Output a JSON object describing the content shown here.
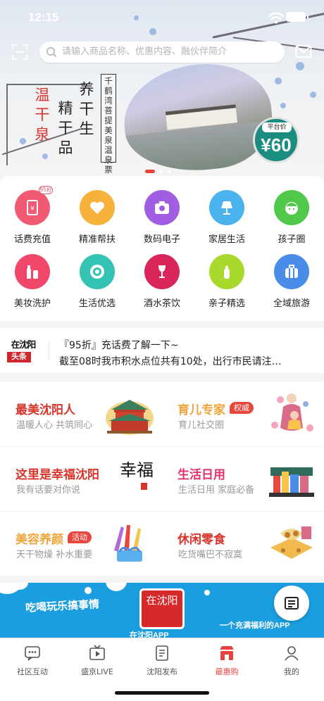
{
  "status_bar": {
    "time": "12:15"
  },
  "search": {
    "placeholder": "请输入商品名称、优惠内容、融伙伴简介"
  },
  "banner": {
    "left_text_1": "温干泉",
    "left_text_2": "精干品",
    "left_text_3": "养干生",
    "vertical_tag": "千鹤湾菩提美泉温泉票",
    "price_label": "平台价",
    "price_value": "¥60",
    "slide_index": 1,
    "slide_count": 3
  },
  "grid": {
    "items": [
      {
        "label": "话费充值",
        "icon": "phone-recharge-icon",
        "badge": "95折",
        "color": "#f25a74"
      },
      {
        "label": "精准帮扶",
        "icon": "heart-hands-icon",
        "color": "#f7b23c"
      },
      {
        "label": "数码电子",
        "icon": "camera-icon",
        "color": "#a25ee2"
      },
      {
        "label": "家居生活",
        "icon": "lamp-icon",
        "color": "#4ab3ee"
      },
      {
        "label": "孩子圈",
        "icon": "child-face-icon",
        "color": "#50c94b"
      },
      {
        "label": "美妆洗护",
        "icon": "cosmetics-icon",
        "color": "#f0476a"
      },
      {
        "label": "生活优选",
        "icon": "plate-icon",
        "color": "#34c2b2"
      },
      {
        "label": "酒水茶饮",
        "icon": "wine-icon",
        "color": "#d9265a"
      },
      {
        "label": "亲子精选",
        "icon": "baby-bottle-icon",
        "color": "#a9d92c"
      },
      {
        "label": "全域旅游",
        "icon": "suitcase-icon",
        "color": "#4a8de8"
      }
    ]
  },
  "news": {
    "logo_top": "在沈阳",
    "logo_bottom": "头条",
    "line1": "『95折』充话费了解一下~",
    "line2": "截至08时我市积水点位共有10处，出行市民请注…"
  },
  "categories": [
    {
      "title": "最美沈阳人",
      "subtitle": "温暖人心 共筑同心",
      "title_color": "#d8342b",
      "art": "palace-illustration"
    },
    {
      "title": "育儿专家",
      "subtitle": "育儿社交圈",
      "tag": "权威",
      "title_color": "#f0a43a",
      "art": "mother-child-illustration"
    },
    {
      "title": "这里是幸福沈阳",
      "subtitle": "我有话要对你说",
      "title_color": "#d8342b",
      "art": "calligraphy-art",
      "art_text": "幸福"
    },
    {
      "title": "生活日用",
      "subtitle": "生活日用 家庭必备",
      "title_color": "#e0306f",
      "art": "daily-goods-illustration"
    },
    {
      "title": "美容养颜",
      "subtitle": "天干物燥 补水重要",
      "tag": "活动",
      "title_color": "#f0a43a",
      "art": "cosmetics-gift-illustration"
    },
    {
      "title": "休闲零食",
      "subtitle": "吃货嘴巴不寂寞",
      "title_color": "#d8342b",
      "art": "snacks-illustration"
    }
  ],
  "promo": {
    "left_text": "吃喝玩乐搞事情",
    "logo_text": "在沈阳",
    "right_text": "一个充满福利的APP",
    "bottom_text": "在沈阳APP"
  },
  "tabs": [
    {
      "label": "社区互动",
      "icon": "chat-bubble-icon",
      "active": false
    },
    {
      "label": "盛京LIVE",
      "icon": "tv-play-icon",
      "active": false
    },
    {
      "label": "沈阳发布",
      "icon": "document-icon",
      "active": false
    },
    {
      "label": "最惠购",
      "icon": "shop-icon",
      "active": true
    },
    {
      "label": "我的",
      "icon": "person-icon",
      "active": false
    }
  ],
  "colors": {
    "accent": "#e8423f",
    "promo_bg": "#1a9ee0",
    "price_badge": "#1a8d80"
  }
}
